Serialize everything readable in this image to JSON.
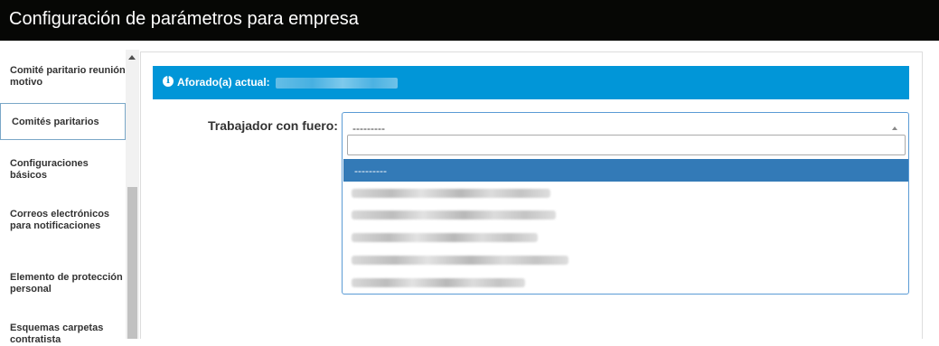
{
  "window": {
    "title": "Configuración de parámetros para empresa"
  },
  "sidebar": {
    "items": [
      {
        "label": "Comité paritario reunión motivo"
      },
      {
        "label": "Comités paritarios",
        "active": true
      },
      {
        "label": "Configuraciones básicos"
      },
      {
        "label": "Correos electrónicos para notificaciones"
      },
      {
        "label": "Elemento de protección personal"
      },
      {
        "label": "Esquemas carpetas contratista"
      }
    ]
  },
  "alert": {
    "icon": "info-circle-icon",
    "label": "Aforado(a) actual:",
    "color": "#0196d8"
  },
  "form": {
    "field_label": "Trabajador con fuero:",
    "select_value": "---------",
    "options": [
      {
        "label": "---------",
        "selected": true
      }
    ],
    "accent_color": "#337ab7"
  }
}
